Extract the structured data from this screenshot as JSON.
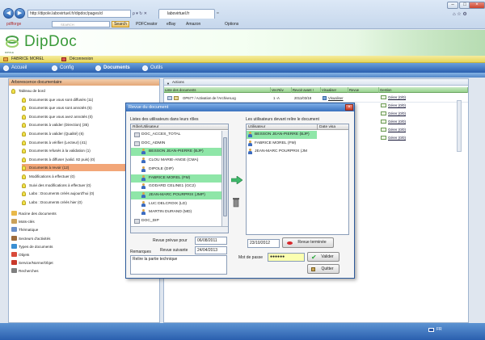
{
  "browser": {
    "url": "http://dipole.labovirtuel.fr/dipdoc/pages/d",
    "tab_title": "labovirtuel.fr",
    "search_placeholder": "SEARCH",
    "search_button": "Search",
    "toolbar_items": [
      "pdfforge",
      "PDFCreator",
      "eBay",
      "Amazon",
      "Options"
    ]
  },
  "app": {
    "logo": "DipDoc",
    "logo_sub": "DIPOLE",
    "user": "FABRICE MOREL",
    "logout": "Déconnexion",
    "menu": [
      "Accueil",
      "Config",
      "Documents",
      "Outils"
    ],
    "active_menu": "Documents"
  },
  "left_panel": {
    "title": "Arborescence documentaire",
    "items": [
      {
        "label": "Tableau de bord",
        "level": 0,
        "icon": "bulb-icon"
      },
      {
        "label": "Documents que vous sont diffusés (11)",
        "level": 1,
        "icon": "bulb-icon"
      },
      {
        "label": "Documents que vous sont annotés (5)",
        "level": 1,
        "icon": "bulb-icon"
      },
      {
        "label": "Documents que vous avez annotés (0)",
        "level": 1,
        "icon": "bulb-icon"
      },
      {
        "label": "Documents à valider (Direction) (35)",
        "level": 1,
        "icon": "bulb-icon"
      },
      {
        "label": "Documents à valider (Qualité) (6)",
        "level": 1,
        "icon": "bulb-icon"
      },
      {
        "label": "Documents à vérifier (Lecteur) (41)",
        "level": 1,
        "icon": "bulb-icon"
      },
      {
        "label": "Documents refusés à la validation (1)",
        "level": 1,
        "icon": "bulb-icon"
      },
      {
        "label": "Documents à diffuser (valid. 82 puis) (0)",
        "level": 1,
        "icon": "bulb-icon"
      },
      {
        "label": "Documents à revoir (12)",
        "level": 1,
        "icon": "bulb-icon",
        "selected": true
      },
      {
        "label": "Modifications à effectuer (0)",
        "level": 1,
        "icon": "bulb-icon"
      },
      {
        "label": "Suivi des modifications à effectuer (0)",
        "level": 1,
        "icon": "bulb-icon"
      },
      {
        "label": "Labo : Documents créés aujourd'hui (0)",
        "level": 1,
        "icon": "bulb-icon"
      },
      {
        "label": "Labo : Documents créés hier (0)",
        "level": 1,
        "icon": "bulb-icon"
      },
      {
        "label": "Racine des documents",
        "level": 0,
        "icon": "folder-icon"
      },
      {
        "label": "Mots-clés",
        "level": 0,
        "icon": "keys-icon"
      },
      {
        "label": "Thématique",
        "level": 0,
        "icon": "theme-icon"
      },
      {
        "label": "Secteurs d'activités",
        "level": 0,
        "icon": "sector-icon"
      },
      {
        "label": "Types de documents",
        "level": 0,
        "icon": "globe-icon"
      },
      {
        "label": "Objets",
        "level": 0,
        "icon": "object-icon"
      },
      {
        "label": "Service/Norme/Objet",
        "level": 0,
        "icon": "service-icon"
      },
      {
        "label": "Recherches",
        "level": 0,
        "icon": "search-icon"
      }
    ]
  },
  "main": {
    "actions_label": "Actions",
    "grid_columns": [
      "Liste des documents",
      "Ver.Rév",
      "Revoir avant !",
      "Visualiser",
      "Revue",
      "Gestion"
    ],
    "row1": {
      "doc": "OP677 / Activation de l'ArchiveLog",
      "ver": "1 -A",
      "date": "2011/03/18",
      "view": "Visualiser",
      "gestion": "Gérer (0/0)"
    },
    "gestion_links": [
      "Gérer (0/0)",
      "Gérer (0/0)",
      "Gérer (0/0)",
      "Gérer (0/0)",
      "Gérer (0/0)",
      "Gérer (0/0)"
    ]
  },
  "modal": {
    "title": "Revue du document",
    "left_caption": "Listes des utilisateurs dans leurs rôles",
    "left_header": "Rôle/Utilisateur",
    "left_rows": [
      {
        "label": "DOC_ACCES_TOTAL",
        "type": "group",
        "indent": 0,
        "hl": false
      },
      {
        "label": "DOC_ADMIN",
        "type": "group",
        "indent": 0,
        "hl": false
      },
      {
        "label": "BESSON JEAN-PIERRE (BJP)",
        "type": "user",
        "indent": 1,
        "hl": true
      },
      {
        "label": "CLOU MARIE-ANGE (CMA)",
        "type": "user",
        "indent": 1,
        "hl": false
      },
      {
        "label": "DIPOLE (DIP)",
        "type": "user",
        "indent": 1,
        "hl": false
      },
      {
        "label": "FABRICE MOREL (FM)",
        "type": "user",
        "indent": 1,
        "hl": true
      },
      {
        "label": "GODARD CELINE1 (GC2)",
        "type": "user",
        "indent": 1,
        "hl": false
      },
      {
        "label": "JEAN-MARC POURPRIX (JMP)",
        "type": "user",
        "indent": 1,
        "hl": true
      },
      {
        "label": "LUC DELCROIX (LD)",
        "type": "user",
        "indent": 1,
        "hl": false
      },
      {
        "label": "MARTIN DURAND (MD)",
        "type": "user",
        "indent": 1,
        "hl": false
      },
      {
        "label": "DOC_DIP",
        "type": "group",
        "indent": 0,
        "hl": false
      }
    ],
    "right_caption": "Les utilisateurs devant relire le document",
    "right_headers": [
      "Utilisateur",
      "Date visa"
    ],
    "right_rows": [
      {
        "label": "BESSON JEAN-PIERRE (BJP)",
        "hl": true
      },
      {
        "label": "FABRICE MOREL (FM)",
        "hl": false
      },
      {
        "label": "JEAN-MARC POURPRIX (JM",
        "hl": false
      }
    ],
    "revue_prevue_label": "Revue prévue pour",
    "revue_prevue": "06/08/2011",
    "revue_suivante_label": "Revue suivante",
    "revue_suivante": "24/04/2013",
    "remarques_label": "Remarques",
    "remarques": "Relire la partie technique",
    "date_field": "23/10/2012",
    "revue_terminee": "Revue terminée",
    "password_label": "Mot de passe",
    "password": "●●●●●●",
    "valider": "Valider",
    "quitter": "Quitter"
  },
  "footer": {
    "lang": "FR"
  }
}
